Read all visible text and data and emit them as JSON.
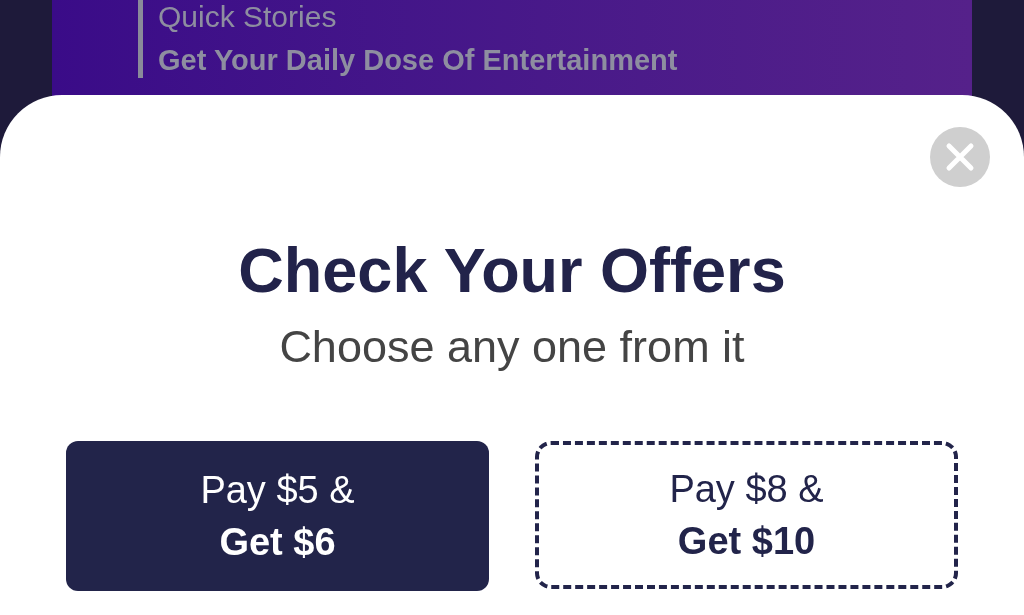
{
  "banner": {
    "title": "Quick Stories",
    "subtitle": "Get Your Daily Dose Of Entertainment"
  },
  "sheet": {
    "title": "Check Your Offers",
    "subtitle": "Choose any one from it",
    "offers": [
      {
        "pay": "Pay $5 &",
        "get": "Get $6",
        "selected": true
      },
      {
        "pay": "Pay $8 &",
        "get": "Get $10",
        "selected": false
      }
    ]
  }
}
